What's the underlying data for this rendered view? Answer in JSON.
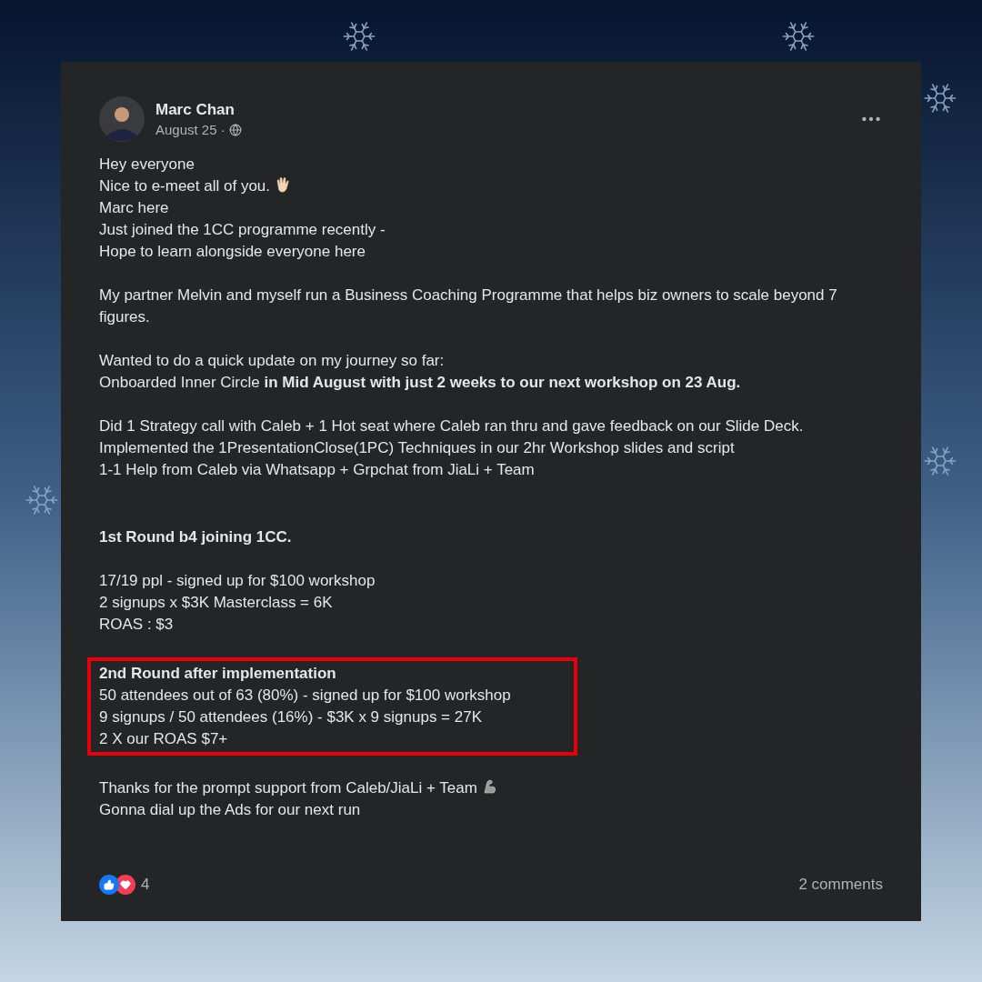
{
  "post": {
    "author": "Marc Chan",
    "date": "August 25 ·",
    "blocks": [
      {
        "highlighted": false,
        "lines": [
          {
            "text": "Hey everyone",
            "bold": false
          },
          {
            "text": "Nice to e-meet all of you.",
            "bold": false,
            "kind": "wave"
          },
          {
            "text": "Marc here",
            "bold": false
          },
          {
            "text": "Just joined the 1CC programme recently -",
            "bold": false
          },
          {
            "text": "Hope to learn alongside everyone here",
            "bold": false
          }
        ]
      },
      {
        "highlighted": false,
        "lines": [
          {
            "text": "My partner Melvin and myself run a Business Coaching Programme that helps biz owners to scale beyond 7 figures.",
            "bold": false
          }
        ]
      },
      {
        "highlighted": false,
        "lines": [
          {
            "text": "Wanted to do a quick update on my journey so far:",
            "bold": false
          },
          {
            "text": "Onboarded Inner Circle **in Mid August with just 2 weeks to our next workshop on 23 Aug.**",
            "bold": false
          }
        ]
      },
      {
        "highlighted": false,
        "lines": [
          {
            "text": "Did 1 Strategy call with Caleb + 1 Hot seat where Caleb ran thru and gave feedback on our Slide Deck.",
            "bold": false
          },
          {
            "text": "Implemented the 1PresentationClose(1PC) Techniques in our 2hr Workshop slides and script",
            "bold": false
          },
          {
            "text": "1-1 Help from Caleb via Whatsapp + Grpchat from JiaLi + Team",
            "bold": false
          }
        ]
      },
      {
        "highlighted": false,
        "lines": [
          {
            "text": "1st Round b4 joining 1CC.",
            "bold": true
          }
        ]
      },
      {
        "highlighted": false,
        "lines": [
          {
            "text": "17/19 ppl - signed up for $100 workshop",
            "bold": false
          },
          {
            "text": "2 signups x $3K Masterclass = 6K",
            "bold": false
          },
          {
            "text": "ROAS : $3",
            "bold": false
          }
        ]
      },
      {
        "highlighted": true,
        "lines": [
          {
            "text": "2nd Round after implementation",
            "bold": true
          },
          {
            "text": "50 attendees out of 63 (80%) - signed up for $100 workshop",
            "bold": false
          },
          {
            "text": "9 signups / 50 attendees (16%) - $3K x 9 signups = 27K",
            "bold": false
          },
          {
            "text": "2 X our ROAS $7+",
            "bold": false
          }
        ]
      },
      {
        "highlighted": false,
        "lines": [
          {
            "text": "Thanks for the prompt support from Caleb/JiaLi + Team",
            "bold": false,
            "kind": "arm"
          },
          {
            "text": "Gonna dial up the Ads for our next run",
            "bold": false
          }
        ]
      }
    ],
    "reaction_count": "4",
    "comments": "2 comments"
  }
}
